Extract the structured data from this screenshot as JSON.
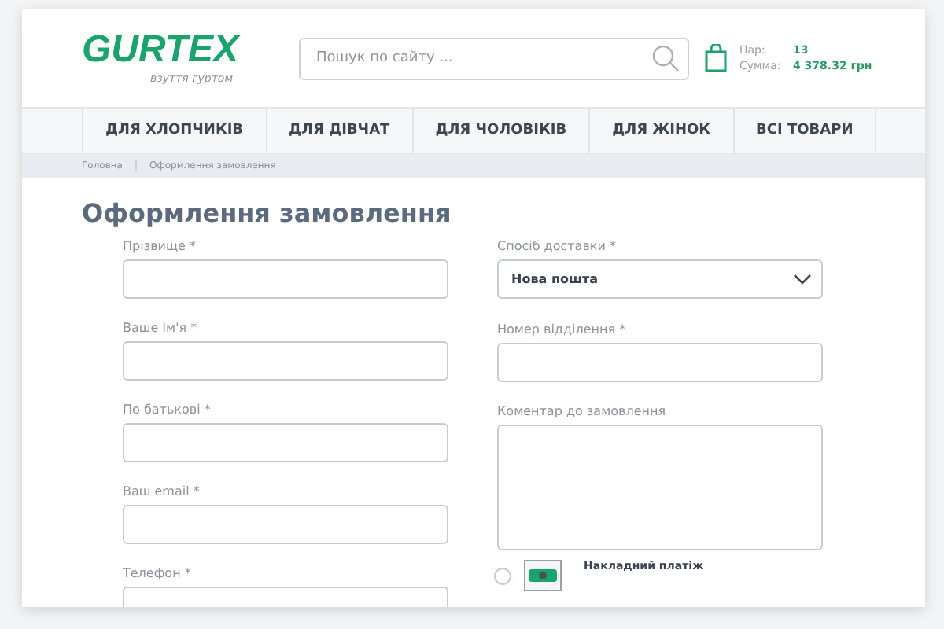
{
  "logo": {
    "name": "GURTEX",
    "tagline": "взуття гуртом"
  },
  "search": {
    "placeholder": "Пошук по сайту ..."
  },
  "cart": {
    "pairs_label": "Пар:",
    "pairs_value": "13",
    "sum_label": "Сумма:",
    "sum_value": "4 378.32 грн"
  },
  "nav": [
    "ДЛЯ ХЛОПЧИКІВ",
    "ДЛЯ ДІВЧАТ",
    "ДЛЯ ЧОЛОВІКІВ",
    "ДЛЯ ЖІНОК",
    "ВСІ ТОВАРИ"
  ],
  "breadcrumbs": [
    "Головна",
    "Оформлення замовлення"
  ],
  "title": "Оформлення замовлення",
  "left_fields": [
    {
      "label": "Прізвище *"
    },
    {
      "label": "Ваше Ім'я *"
    },
    {
      "label": "По батькові *"
    },
    {
      "label": "Ваш email *"
    },
    {
      "label": "Телефон *"
    }
  ],
  "right_fields": [
    {
      "kind": "select",
      "label": "Спосіб доставки *",
      "value": "Нова пошта"
    },
    {
      "kind": "input",
      "label": "Номер відділення *"
    },
    {
      "kind": "textarea",
      "label": "Коментар до замовлення"
    }
  ],
  "payment": [
    {
      "label": "Накладний платіж",
      "selected": false
    }
  ]
}
